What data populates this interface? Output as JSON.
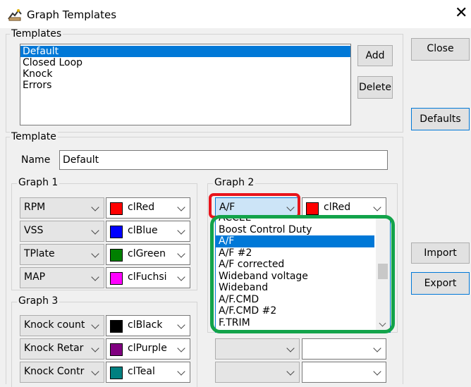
{
  "window": {
    "title": "Graph Templates",
    "close_glyph": "✕"
  },
  "templates_group": {
    "label": "Templates",
    "items": [
      "Default",
      "Closed Loop",
      "Knock",
      "Errors"
    ],
    "selected_index": 0,
    "add_label": "Add",
    "delete_label": "Delete"
  },
  "side_buttons": {
    "close_label": "Close",
    "defaults_label": "Defaults",
    "import_label": "Import",
    "export_label": "Export"
  },
  "template_group": {
    "label": "Template",
    "name_label": "Name",
    "name_value": "Default"
  },
  "graph1": {
    "label": "Graph 1",
    "rows": [
      {
        "channel": "RPM",
        "color_name": "clRed",
        "color": "#ff0000"
      },
      {
        "channel": "VSS",
        "color_name": "clBlue",
        "color": "#0000ff"
      },
      {
        "channel": "TPlate",
        "color_name": "clGreen",
        "color": "#008000"
      },
      {
        "channel": "MAP",
        "color_name": "clFuchsi",
        "color": "#ff00ff"
      }
    ]
  },
  "graph2": {
    "label": "Graph 2",
    "channel": "A/F",
    "color_name": "clRed",
    "color": "#ff0000",
    "dropdown": {
      "items": [
        "ACCEL",
        "Boost Control Duty",
        "A/F",
        "A/F #2",
        "A/F corrected",
        "Wideband voltage",
        "Wideband",
        "A/F.CMD",
        "A/F.CMD #2",
        "F.TRIM"
      ],
      "selected_index": 2
    }
  },
  "graph3": {
    "label": "Graph 3",
    "rows": [
      {
        "channel": "Knock count",
        "color_name": "clBlack",
        "color": "#000000"
      },
      {
        "channel": "Knock Retar",
        "color_name": "clPurple",
        "color": "#800080"
      },
      {
        "channel": "Knock Contr",
        "color_name": "clTeal",
        "color": "#008080"
      }
    ]
  },
  "annotations": {
    "red_box_color": "#e8141b",
    "green_box_color": "#12a34a"
  }
}
